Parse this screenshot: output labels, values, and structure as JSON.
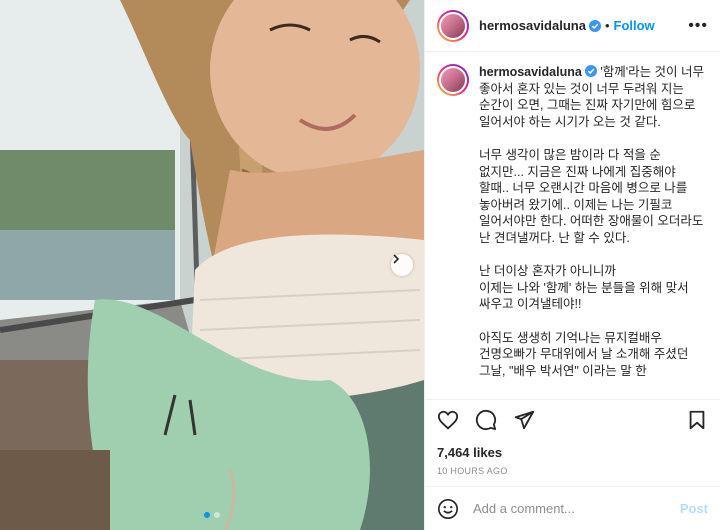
{
  "post": {
    "username": "hermosavidaluna",
    "follow_label": "Follow",
    "separator": "•",
    "more_label": "•••",
    "caption_username": "hermosavidaluna",
    "caption": "'함께'라는 것이 너무 좋아서 혼자 있는 것이 너무 두려워 지는 순간이 오면, 그때는 진짜 자기만에 힘으로 일어서야 하는 시기가 오는 것 같다.\n\n너무 생각이 많은 밤이라 다 적을 순 없지만... 지금은 진짜 나에게 집중해야 할때.. 너무 오랜시간 마음에 병으로 나를 놓아버려 왔기에.. 이제는 나는 기필코 일어서야만 한다. 어떠한 장애물이 오더라도 난 견뎌낼꺼다. 난 할 수 있다.\n\n난 더이상 혼자가 아니니까\n이제는 나와 '함께' 하는 분들을 위해 맞서 싸우고 이겨낼테야!!\n\n아직도 생생히 기억나는 뮤지컬배우 건명오빠가 무대위에서 날 소개해 주셨던 그날, \"배우 박서연\" 이라는 말 한",
    "likes": "7,464 likes",
    "timestamp": "10 HOURS AGO",
    "comment_placeholder": "Add a comment...",
    "post_label": "Post"
  },
  "colors": {
    "accent": "#0095f6",
    "post_disabled": "#b2dffc",
    "muted": "#8e8e8e"
  },
  "icons": {
    "verified": "verified-badge-icon",
    "like": "heart-icon",
    "comment": "comment-icon",
    "share": "paper-plane-icon",
    "save": "bookmark-icon",
    "emoji": "smiley-icon",
    "next": "chevron-right-icon"
  },
  "carousel": {
    "slide_count": 2,
    "active_index": 0
  }
}
